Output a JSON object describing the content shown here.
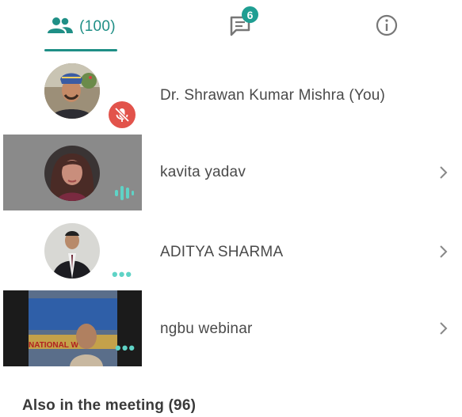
{
  "tabs": {
    "people_count": "(100)",
    "chat_badge": "6"
  },
  "participants": [
    {
      "name": "Dr. Shrawan Kumar Mishra (You)"
    },
    {
      "name": "kavita yadav"
    },
    {
      "name": "ADITYA SHARMA"
    },
    {
      "name": "ngbu webinar"
    }
  ],
  "banner_text": "NATIONAL W",
  "also_in_meeting": "Also in the meeting (96)",
  "colors": {
    "accent": "#1f8f86",
    "muted_red": "#e2534b",
    "speaking": "#5fd3c6"
  }
}
